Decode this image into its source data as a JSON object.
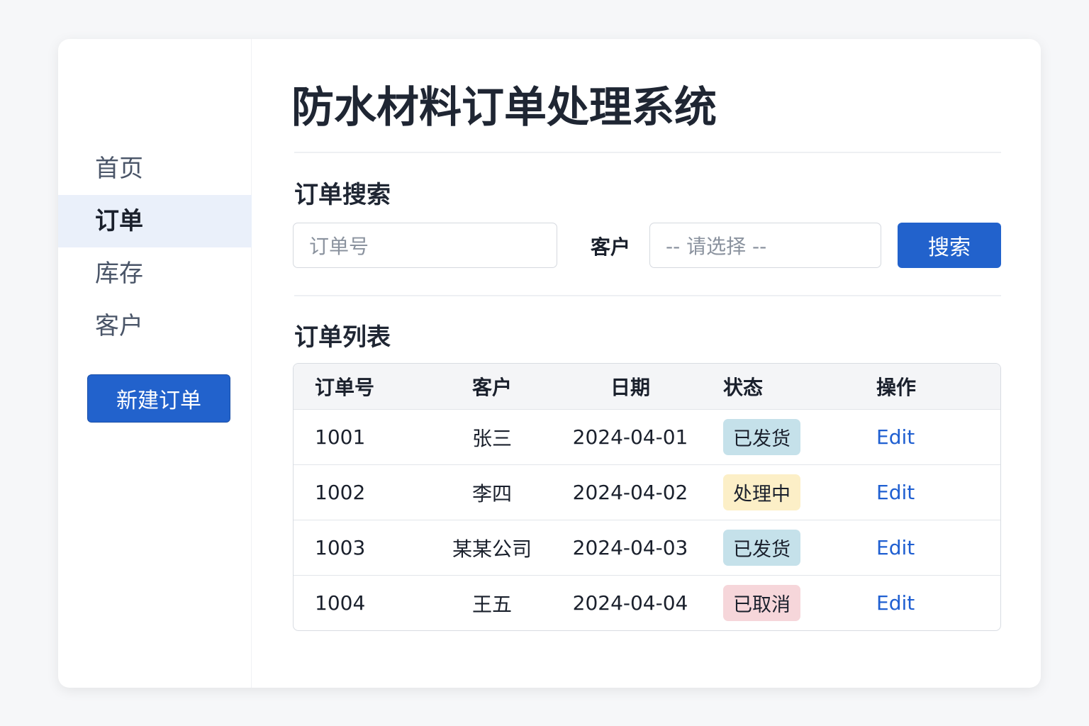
{
  "sidebar": {
    "items": [
      {
        "label": "首页"
      },
      {
        "label": "订单",
        "active": true
      },
      {
        "label": "库存"
      },
      {
        "label": "客户"
      }
    ],
    "new_order": "新建订单"
  },
  "header": {
    "title": "防水材料订单处理系统"
  },
  "search": {
    "heading": "订单搜索",
    "order_placeholder": "订单号",
    "customer_label": "客户",
    "customer_select": "-- 请选择 --",
    "button": "搜索"
  },
  "list": {
    "heading": "订单列表",
    "columns": [
      "订单号",
      "客户",
      "日期",
      "状态",
      "操作"
    ],
    "rows": [
      {
        "id": "1001",
        "customer": "张三",
        "date": "2024-04-01",
        "status": "已发货",
        "action": "Edit"
      },
      {
        "id": "1002",
        "customer": "李四",
        "date": "2024-04-02",
        "status": "处理中",
        "action": "Edit"
      },
      {
        "id": "1003",
        "customer": "某某公司",
        "date": "2024-04-03",
        "status": "已发货",
        "action": "Edit"
      },
      {
        "id": "1004",
        "customer": "王五",
        "date": "2024-04-04",
        "status": "已取消",
        "action": "Edit"
      }
    ]
  },
  "colors": {
    "accent": "#2262cc",
    "shipped": "#c5e1ea",
    "processing": "#fcefc7",
    "cancelled": "#f6d6da"
  }
}
